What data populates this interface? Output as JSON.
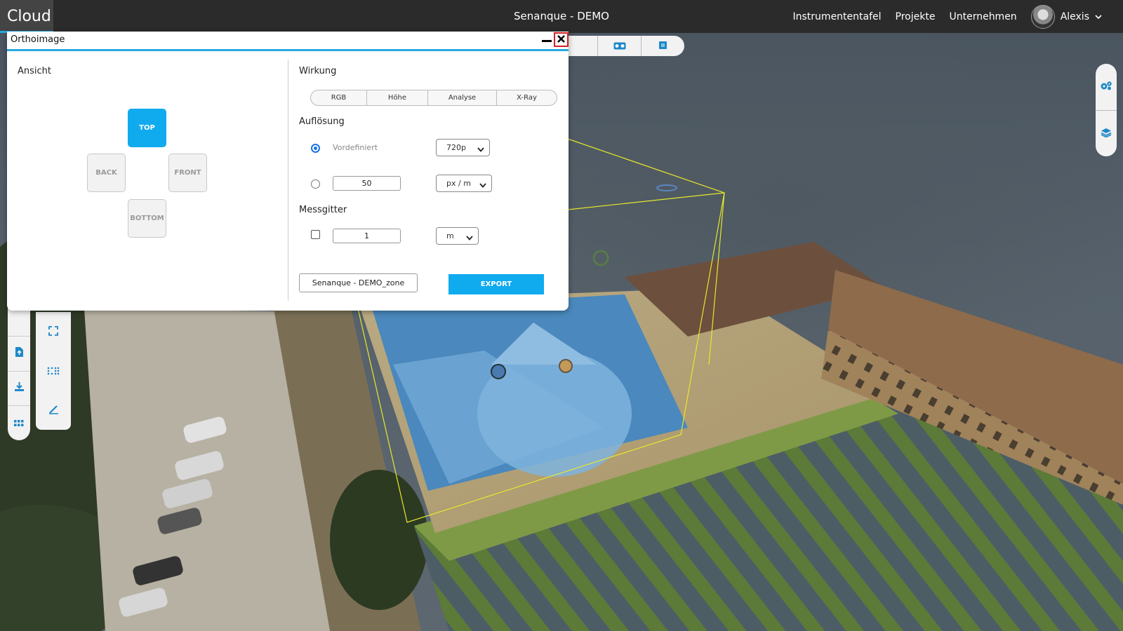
{
  "app": {
    "brand": "Cloud",
    "project_title": "Senanque - DEMO"
  },
  "nav": {
    "items": [
      {
        "label": "Instrumententafel"
      },
      {
        "label": "Projekte"
      },
      {
        "label": "Unternehmen"
      }
    ],
    "user_name": "Alexis"
  },
  "dialog": {
    "title": "Orthoimage",
    "view": {
      "label": "Ansicht",
      "buttons": [
        {
          "label": "TOP",
          "active": true
        },
        {
          "label": "BACK"
        },
        {
          "label": "FRONT"
        },
        {
          "label": "BOTTOM"
        }
      ]
    },
    "effect": {
      "label": "Wirkung",
      "options": [
        {
          "label": "RGB"
        },
        {
          "label": "Höhe"
        },
        {
          "label": "Analyse"
        },
        {
          "label": "X-Ray"
        }
      ]
    },
    "resolution": {
      "label": "Auflösung",
      "predefined_label": "Vordefiniert",
      "predefined_checked": true,
      "predefined_value": "720p",
      "custom_value": "50",
      "custom_unit": "px / m"
    },
    "grid": {
      "label": "Messgitter",
      "enabled": false,
      "value": "1",
      "unit": "m"
    },
    "filename": "Senanque - DEMO_zone",
    "export_label": "EXPORT"
  },
  "colors": {
    "accent": "#10aaef",
    "topbar": "#2b2b2b",
    "close_border": "#d42020",
    "bbox_line": "#e8e82a"
  },
  "icons": {
    "top_tools": [
      "vr-headset-icon",
      "cube-icon"
    ],
    "right_tools": [
      "settings-gears-icon",
      "layers-icon"
    ],
    "left_tools_a": [
      "upload-file-icon",
      "download-icon",
      "grid-apps-icon"
    ],
    "left_tools_b": [
      "fullscreen-icon",
      "dotted-grid-icon",
      "measure-pen-icon"
    ]
  }
}
